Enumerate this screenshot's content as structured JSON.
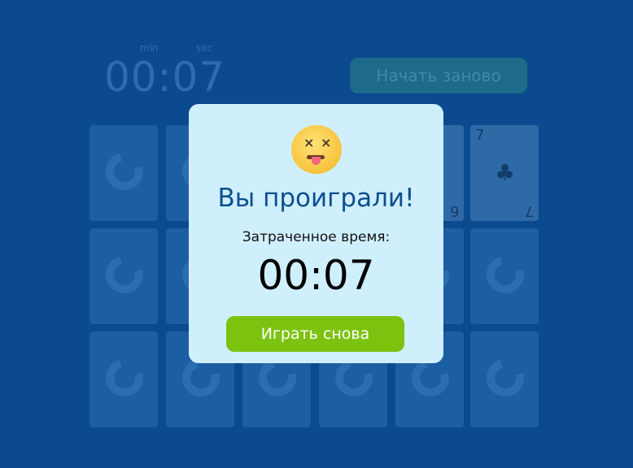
{
  "timer": {
    "min_label": "min",
    "sec_label": "sec",
    "value": "00:07"
  },
  "toolbar": {
    "restart_label": "Начать заново"
  },
  "cards": {
    "face_up": {
      "rank": "7",
      "suit": "♣",
      "partial_rank": "6"
    }
  },
  "modal": {
    "title": "Вы проиграли!",
    "time_label": "Затраченное время:",
    "time_value": "00:07",
    "play_again_label": "Играть снова",
    "emoji": "dizzy-face-icon"
  },
  "colors": {
    "background": "#0b4a8f",
    "modal_bg": "#cfeffc",
    "title": "#0c4f8f",
    "play_button": "#7cc310"
  }
}
